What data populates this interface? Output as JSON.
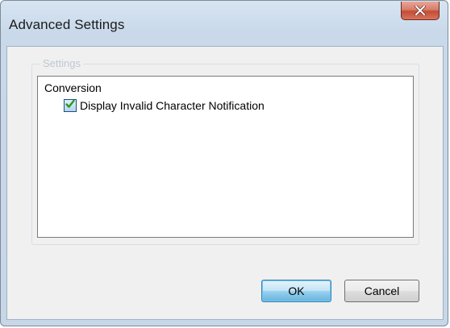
{
  "window": {
    "title": "Advanced Settings",
    "close_icon": "close-icon"
  },
  "settings_group": {
    "label": "Settings",
    "category": "Conversion",
    "options": [
      {
        "label": "Display Invalid Character Notification",
        "checked": true
      }
    ]
  },
  "buttons": {
    "ok_label": "OK",
    "cancel_label": "Cancel"
  },
  "colors": {
    "close_button": "#c44c34",
    "checkmark": "#2a9a1c",
    "default_button_border": "#3c7fb1"
  }
}
